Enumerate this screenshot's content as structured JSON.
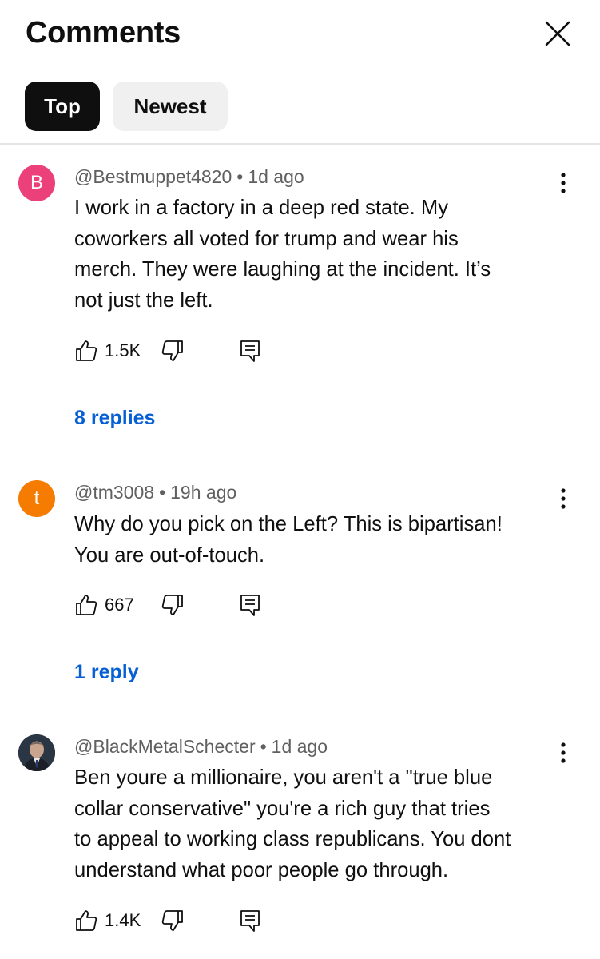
{
  "header": {
    "title": "Comments"
  },
  "filters": {
    "top_label": "Top",
    "newest_label": "Newest"
  },
  "comments": [
    {
      "avatar_letter": "B",
      "author": "@Bestmuppet4820",
      "time": "1d ago",
      "lines": [
        "I work in a factory in a deep red state. My",
        "coworkers all voted for trump and wear his",
        "merch. They were laughing at the incident. It’s",
        "not just the left."
      ],
      "likes": "1.5K",
      "replies": "8 replies"
    },
    {
      "avatar_letter": "t",
      "author": "@tm3008",
      "time": "19h ago",
      "lines": [
        "Why do you pick on the Left? This is bipartisan!",
        "You are out-of-touch."
      ],
      "likes": "667",
      "replies": "1 reply"
    },
    {
      "avatar_letter": "",
      "author": "@BlackMetalSchecter",
      "time": "1d ago",
      "lines": [
        "Ben youre a millionaire, you aren't a \"true blue",
        "collar conservative\" you're a rich guy that tries",
        "to appeal to working class republicans. You dont",
        "understand what poor people go through."
      ],
      "likes": "1.4K"
    }
  ],
  "icons": {
    "close": "close-icon",
    "more": "more-vertical-icon",
    "like": "thumbs-up-icon",
    "dislike": "thumbs-down-icon",
    "reply": "reply-comment-icon"
  },
  "colors": {
    "link_blue": "#065fd4",
    "avatar_b": "#ec407a",
    "avatar_t": "#f57c00",
    "chip_active": "#0f0f0f",
    "chip_inactive": "#f0f0f0"
  }
}
